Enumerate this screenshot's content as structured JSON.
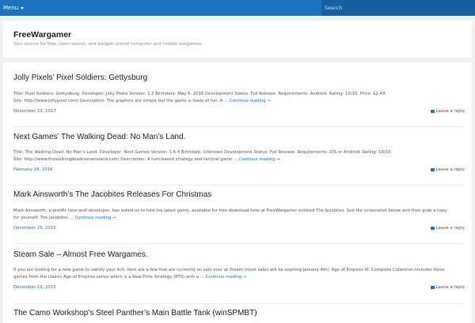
{
  "topbar": {
    "menu_label": "Menu",
    "search_placeholder": "Search"
  },
  "site": {
    "title": "FreeWargamer",
    "description": "Your source for free, open source, and bargain priced computer and mobile wargames."
  },
  "posts": [
    {
      "title": "Jolly Pixels’ Pixel Soldiers: Gettysburg",
      "excerpt_line1": "Title: Pixel Soldiers: Gettysburg. Developer: Jolly Pixels Version: 1.2 Birthdate: May 6, 2016 Development Status: Full Release. Requirements: Android. Rating: 10/10. Price: $2.49.",
      "excerpt_line2": "Site: http://www.jollypixel.com/ Description: The graphics are simple but the game is loads of fun. A …",
      "more": "Continue reading →",
      "date": "November 13, 2017",
      "reply": "Leave a reply"
    },
    {
      "title": "Next Games’ The Walking Dead: No Man’s Land.",
      "excerpt_line1": "Title: The Walking Dead: No Man’s Land. Developer: Next Games Version: 1.6.4 Birthdate: Unknown Development Status: Full Release. Requirements: iOS or Android. Rating: 10/10.",
      "excerpt_line2": "Site: http://www.thewalkingdeadnomansland.com/ Description: A turn-based strategy and tactical game …",
      "more": "Continue reading →",
      "date": "February 18, 2016",
      "reply": "Leave a reply"
    },
    {
      "title": "Mark Ainsworth’s The Jacobites Releases For Christmas",
      "excerpt_line1": "Mark Ainsworth, a prolific lone-wolf developer, has asked us to host his latest game, available for free download here at FreeWargamer entitled The Jacobites. See the screenshot below and then grab a copy",
      "excerpt_line2": "for yourself: The Jacobites …",
      "more": "Continue reading →",
      "date": "December 25, 2015",
      "reply": "Leave a reply"
    },
    {
      "title": "Steam Sale – Almost Free Wargames.",
      "excerpt_line1": "If you are looking for a new game to satisfy your itch, here are a few that are currently on sale over at Steam (most sales will be expiring January 4th): Age of Empires III: Complete Collection Includes three",
      "excerpt_line2": "games from the classic Age of Empires series which is a Real-Time Strategy (RTS) with a …",
      "more": "Continue reading →",
      "date": "December 23, 2015",
      "reply": "Leave a reply"
    },
    {
      "title": "The Camo Workshop’s Steel Panther’s Main Battle Tank (winSPMBT)"
    }
  ]
}
